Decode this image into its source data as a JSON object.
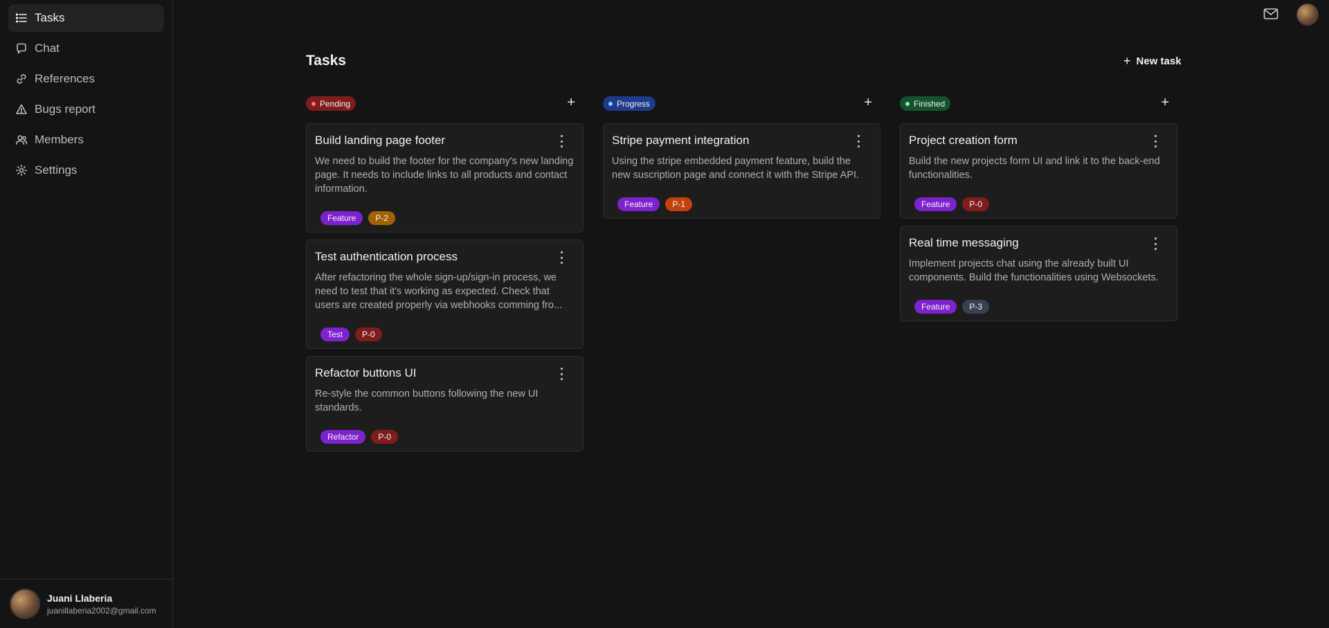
{
  "sidebar": {
    "items": [
      {
        "label": "Tasks",
        "icon": "list-icon",
        "active": true
      },
      {
        "label": "Chat",
        "icon": "chat-icon"
      },
      {
        "label": "References",
        "icon": "link-icon"
      },
      {
        "label": "Bugs report",
        "icon": "warning-icon"
      },
      {
        "label": "Members",
        "icon": "users-icon"
      },
      {
        "label": "Settings",
        "icon": "gear-icon"
      }
    ],
    "user": {
      "name": "Juani Llaberia",
      "email": "juanillaberia2002@gmail.com"
    }
  },
  "header": {
    "mail_icon": "mail-icon"
  },
  "main": {
    "title": "Tasks",
    "new_task_label": "New task",
    "columns": [
      {
        "status": "Pending",
        "status_color": "#7f1d1d",
        "dot_color": "#f87171",
        "cards": [
          {
            "title": "Build landing page footer",
            "description": "We need to build the footer for the company's new landing page. It needs to include links to all products and contact information.",
            "tags": [
              {
                "label": "Feature",
                "color": "#7e22ce"
              },
              {
                "label": "P-2",
                "color": "#a16207"
              }
            ]
          },
          {
            "title": "Test authentication process",
            "description": "After refactoring the whole sign-up/sign-in process, we need to test that it's working as expected. Check that users are created properly via webhooks comming fro...",
            "tags": [
              {
                "label": "Test",
                "color": "#7e22ce"
              },
              {
                "label": "P-0",
                "color": "#7f1d1d"
              }
            ]
          },
          {
            "title": "Refactor buttons UI",
            "description": "Re-style the common buttons following the new UI standards.",
            "tags": [
              {
                "label": "Refactor",
                "color": "#7e22ce"
              },
              {
                "label": "P-0",
                "color": "#7f1d1d"
              }
            ]
          }
        ]
      },
      {
        "status": "Progress",
        "status_color": "#1e3a8a",
        "dot_color": "#93c5fd",
        "cards": [
          {
            "title": "Stripe payment integration",
            "description": "Using the stripe embedded payment feature, build the new suscription page and connect it with the Stripe API.",
            "tags": [
              {
                "label": "Feature",
                "color": "#7e22ce"
              },
              {
                "label": "P-1",
                "color": "#c2410c"
              }
            ]
          }
        ]
      },
      {
        "status": "Finished",
        "status_color": "#14532d",
        "dot_color": "#86efac",
        "cards": [
          {
            "title": "Project creation form",
            "description": "Build the new projects form UI and link it to the back-end functionalities.",
            "tags": [
              {
                "label": "Feature",
                "color": "#7e22ce"
              },
              {
                "label": "P-0",
                "color": "#7f1d1d"
              }
            ]
          },
          {
            "title": "Real time messaging",
            "description": "Implement projects chat using the already built UI components. Build the functionalities using Websockets.",
            "tags": [
              {
                "label": "Feature",
                "color": "#7e22ce"
              },
              {
                "label": "P-3",
                "color": "#374151"
              }
            ]
          }
        ]
      }
    ]
  }
}
